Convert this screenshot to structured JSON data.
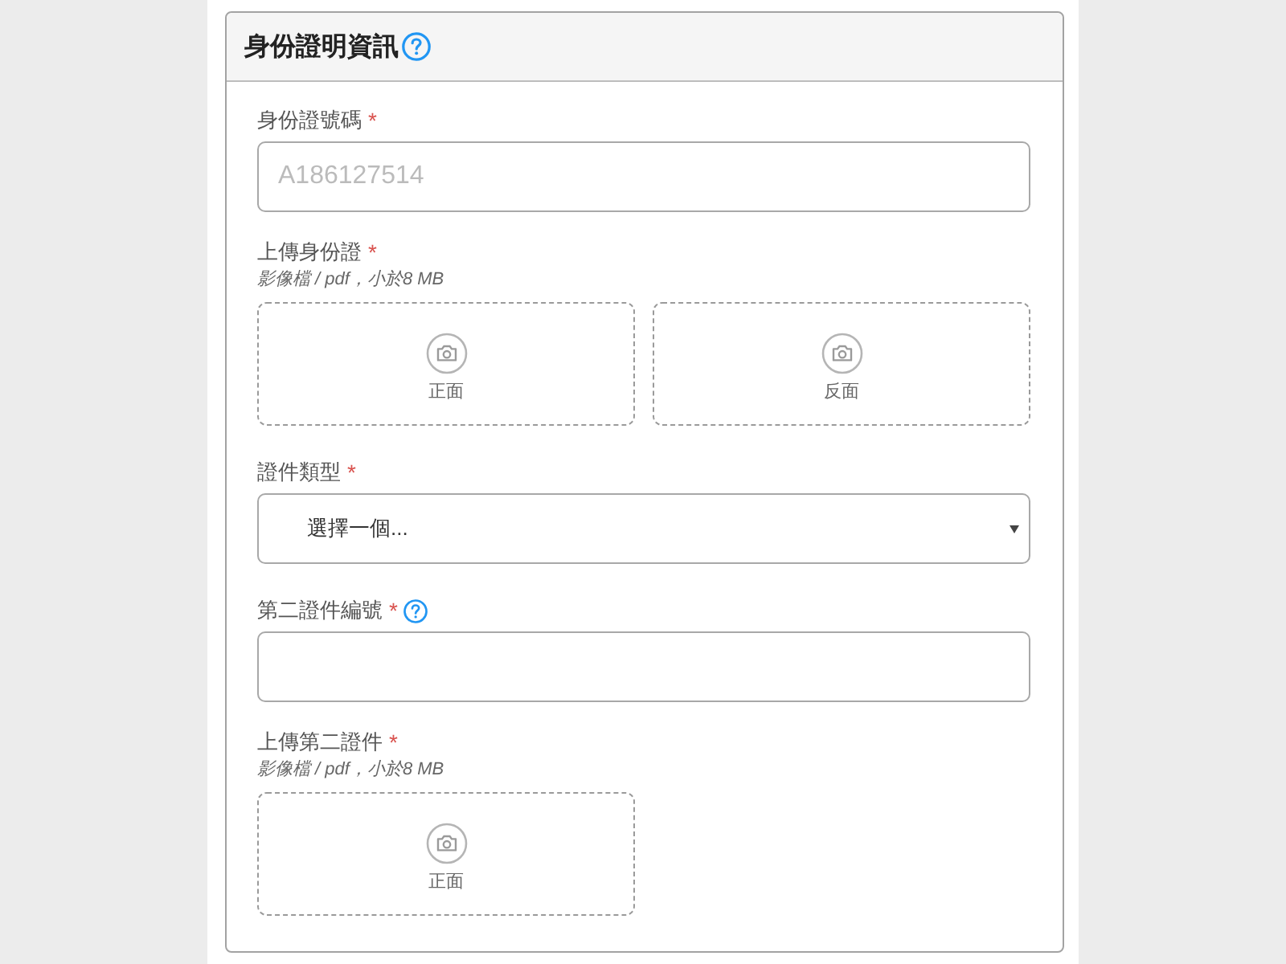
{
  "section": {
    "title": "身份證明資訊",
    "help": true
  },
  "fields": [
    {
      "kind": "text",
      "label": "身份證號碼",
      "required_mark": "*",
      "help": false,
      "placeholder": "A186127514"
    },
    {
      "kind": "upload",
      "label": "上傳身份證",
      "required_mark": "*",
      "help": false,
      "hint": "影像檔 / pdf，小於8 MB",
      "slots": [
        "正面",
        "反面"
      ]
    },
    {
      "kind": "select",
      "label": "證件類型",
      "required_mark": "*",
      "help": false,
      "value": "選擇一個..."
    },
    {
      "kind": "text",
      "label": "第二證件編號",
      "required_mark": "*",
      "help": true
    },
    {
      "kind": "upload",
      "label": "上傳第二證件",
      "required_mark": "*",
      "help": false,
      "hint": "影像檔 / pdf，小於8 MB",
      "slots": [
        "正面"
      ]
    }
  ]
}
